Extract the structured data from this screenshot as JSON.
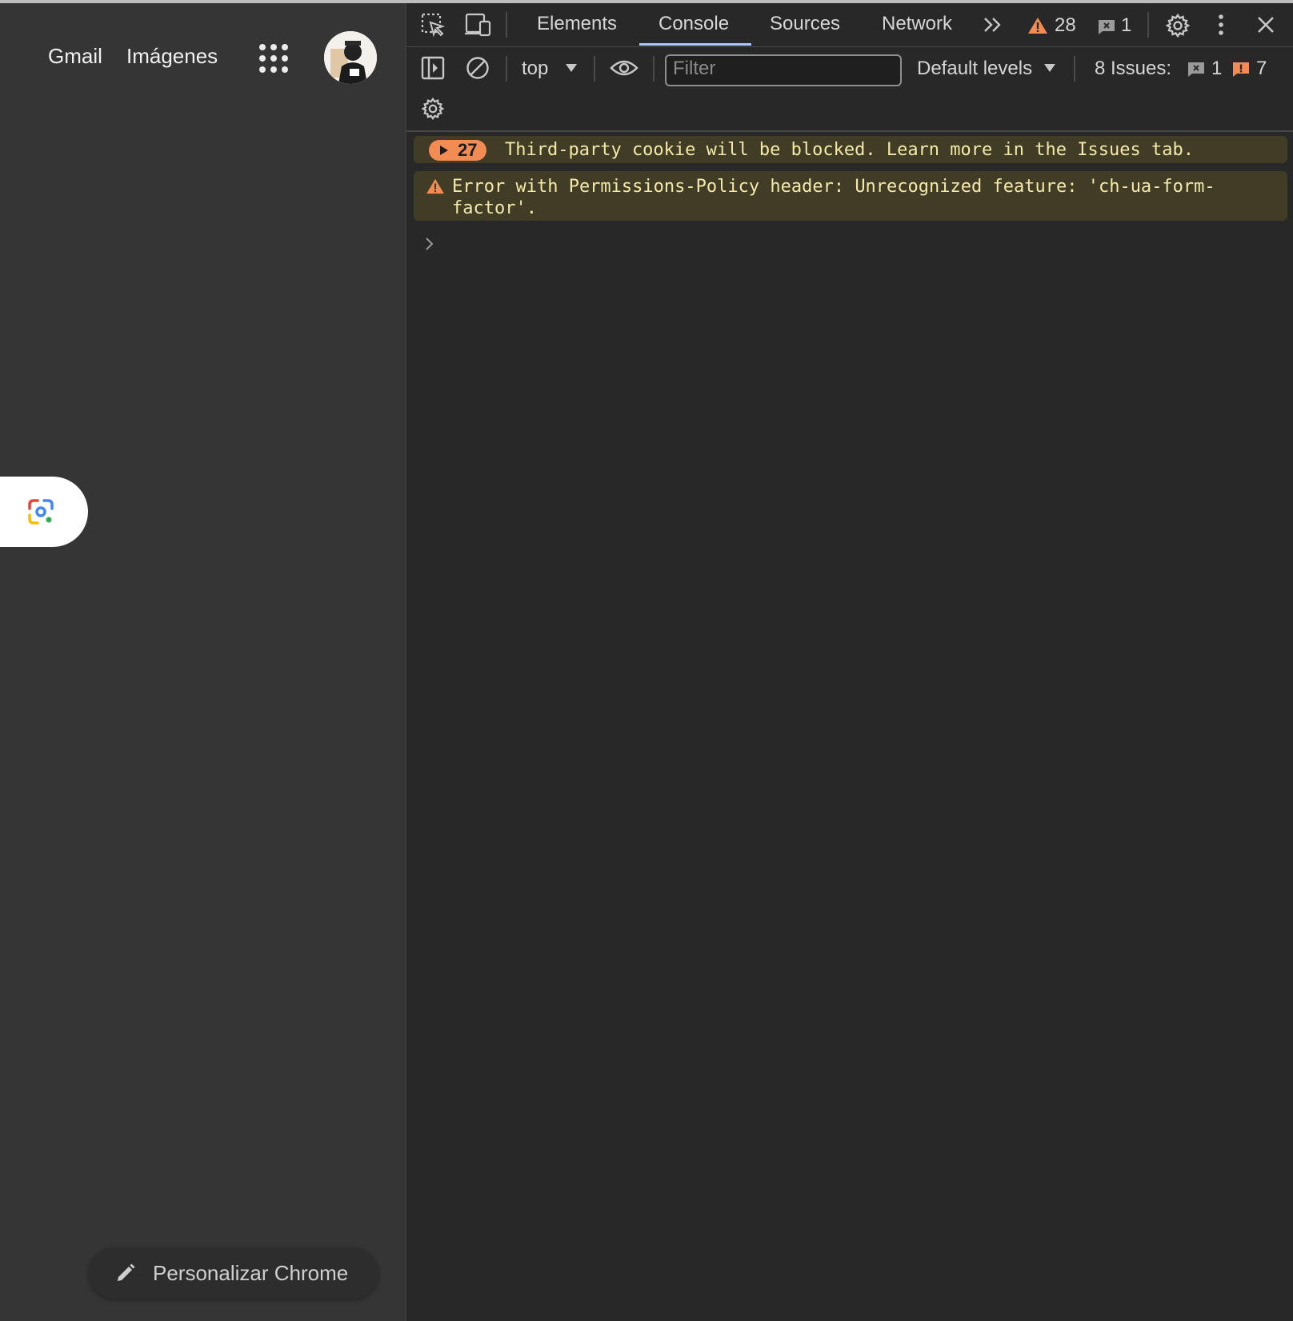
{
  "browser": {
    "links": {
      "gmail": "Gmail",
      "images": "Imágenes"
    },
    "apps_icon": "apps-grid-icon",
    "avatar_icon": "account-avatar",
    "lens_icon": "google-lens-icon",
    "customize_label": "Personalizar Chrome",
    "customize_icon": "pencil-icon"
  },
  "devtools": {
    "tabs": [
      "Elements",
      "Console",
      "Sources",
      "Network"
    ],
    "active_tab": "Console",
    "warnings_count": "28",
    "errors_count": "1",
    "toolbar": {
      "context": "top",
      "filter_placeholder": "Filter",
      "levels": "Default levels",
      "issues_label": "8 Issues:",
      "issues_info_count": "1",
      "issues_warning_count": "7"
    },
    "messages": [
      {
        "repeat": "27",
        "text": "Third-party cookie will be blocked. Learn more in the Issues tab."
      },
      {
        "text": "Error with Permissions-Policy header: Unrecognized feature: 'ch-ua-form-\nfactor'."
      }
    ],
    "colors": {
      "accent": "#a8c7fa",
      "warning": "#f28b54",
      "warning_bg": "#413c26",
      "warning_text": "#f4e9a8"
    }
  }
}
